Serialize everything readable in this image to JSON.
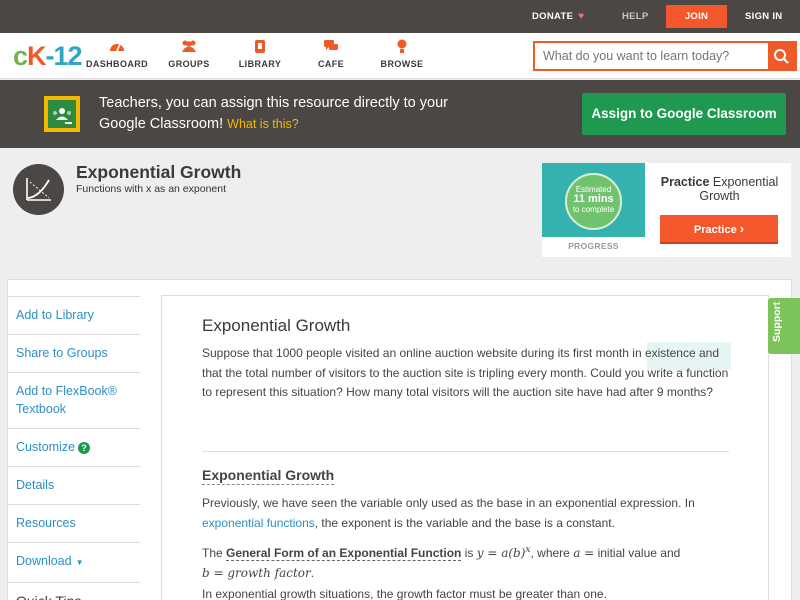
{
  "topbar": {
    "donate": "DONATE",
    "help": "HELP",
    "join": "JOIN",
    "signin": "SIGN IN"
  },
  "nav": {
    "logo": {
      "c": "c",
      "k": "K",
      "n": "-12"
    },
    "items": [
      {
        "label": "DASHBOARD",
        "icon": "dashboard-icon"
      },
      {
        "label": "GROUPS",
        "icon": "groups-icon"
      },
      {
        "label": "LIBRARY",
        "icon": "library-icon"
      },
      {
        "label": "CAFE",
        "icon": "cafe-icon"
      },
      {
        "label": "BROWSE",
        "icon": "browse-icon"
      }
    ],
    "search_placeholder": "What do you want to learn today?"
  },
  "banner": {
    "text": "Teachers, you can assign this resource directly to your Google Classroom!",
    "what_link": "What is this?",
    "assign_button": "Assign to Google Classroom"
  },
  "concept": {
    "title": "Exponential Growth",
    "subtitle": "Functions with x as an exponent"
  },
  "practice": {
    "estimated_line1": "Estimated",
    "estimated_mins": "11 mins",
    "estimated_line3": "to complete",
    "progress_label": "PROGRESS",
    "title_bold": "Practice",
    "title_rest": "Exponential Growth",
    "button": "Practice"
  },
  "sidebar": {
    "items": [
      {
        "label": "Add to Library"
      },
      {
        "label": "Share to Groups"
      },
      {
        "label": "Add to FlexBook® Textbook"
      },
      {
        "label": "Customize"
      },
      {
        "label": "Details"
      },
      {
        "label": "Resources"
      },
      {
        "label": "Download"
      }
    ],
    "quick_tips": "Quick Tips"
  },
  "article": {
    "title": "Exponential Growth",
    "intro": "Suppose that 1000 people visited an online auction website during its first month in existence and that the total number of visitors to the auction site is tripling every month. Could you write a function to represent this situation? How many total visitors will the auction site have had after 9 months?",
    "section_title": "Exponential Growth",
    "p1_before": "Previously, we have seen the variable only used as the base in an exponential expression. In ",
    "p1_link": "exponential functions",
    "p1_after": ", the exponent is the variable and the base is a constant.",
    "p2_the": "The",
    "p2_term": "General Form of an Exponential Function",
    "p2_is": "is",
    "p2_formula": "y = a(b)",
    "p2_exp": "x",
    "p2_where": ", where",
    "p2_a": "a =",
    "p2_initial": "initial value and",
    "p2_b": "b = growth factor",
    "p2_end": ".",
    "p3": "In exponential growth situations, the growth factor must be greater than one."
  },
  "support_tab": "Support",
  "colors": {
    "accent": "#f05a28",
    "dark": "#4a4744",
    "green": "#1f9950",
    "link": "#2e8fc4"
  }
}
